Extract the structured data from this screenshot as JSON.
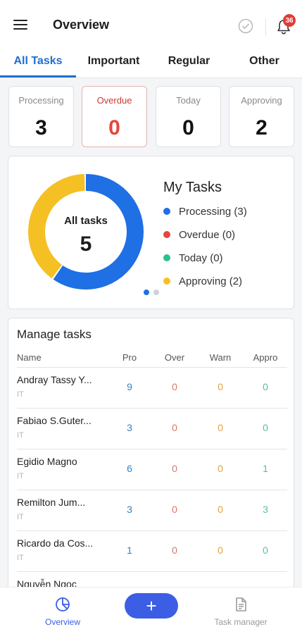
{
  "header": {
    "title": "Overview",
    "notification_count": "36"
  },
  "tabs": [
    {
      "label": "All Tasks",
      "active": true
    },
    {
      "label": "Important",
      "active": false
    },
    {
      "label": "Regular",
      "active": false
    },
    {
      "label": "Other",
      "active": false
    }
  ],
  "stats": [
    {
      "label": "Processing",
      "value": "3"
    },
    {
      "label": "Overdue",
      "value": "0"
    },
    {
      "label": "Today",
      "value": "0"
    },
    {
      "label": "Approving",
      "value": "2"
    }
  ],
  "summary": {
    "center_label": "All tasks",
    "center_value": "5",
    "title": "My Tasks",
    "legend": [
      {
        "label": "Processing (3)",
        "color": "#1f6fe5",
        "value": 3
      },
      {
        "label": "Overdue (0)",
        "color": "#e4463d",
        "value": 0
      },
      {
        "label": "Today (0)",
        "color": "#2bbf91",
        "value": 0
      },
      {
        "label": "Approving (2)",
        "color": "#f5c024",
        "value": 2
      }
    ],
    "pager": {
      "count": 2,
      "active": 0
    }
  },
  "manage": {
    "title": "Manage tasks",
    "columns": [
      "Name",
      "Pro",
      "Over",
      "Warn",
      "Appro"
    ],
    "rows": [
      {
        "name": "Andray Tassy Y...",
        "dept": "IT",
        "pro": "9",
        "over": "0",
        "warn": "0",
        "appro": "0"
      },
      {
        "name": "Fabiao S.Guter...",
        "dept": "IT",
        "pro": "3",
        "over": "0",
        "warn": "0",
        "appro": "0"
      },
      {
        "name": "Egidio Magno",
        "dept": "IT",
        "pro": "6",
        "over": "0",
        "warn": "0",
        "appro": "1"
      },
      {
        "name": "Remilton Jum...",
        "dept": "IT",
        "pro": "3",
        "over": "0",
        "warn": "0",
        "appro": "3"
      },
      {
        "name": "Ricardo da Cos...",
        "dept": "IT",
        "pro": "1",
        "over": "0",
        "warn": "0",
        "appro": "0"
      },
      {
        "name": "Nguyễn Ngọc",
        "dept": "",
        "pro": "",
        "over": "",
        "warn": "",
        "appro": ""
      }
    ]
  },
  "bottom_nav": {
    "overview_label": "Overview",
    "add_label": "+",
    "task_manager_label": "Task manager"
  },
  "colors": {
    "accent": "#1f6fd1",
    "fab": "#3b5ee5"
  }
}
